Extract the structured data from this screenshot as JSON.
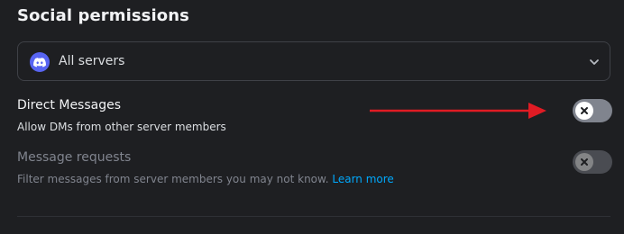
{
  "section": {
    "title": "Social permissions"
  },
  "server_select": {
    "value": "All servers",
    "icon": "discord-logo-icon",
    "accent": "#5865f2"
  },
  "settings": [
    {
      "title": "Direct Messages",
      "description": "Allow DMs from other server members",
      "enabled": false,
      "disabled": false
    },
    {
      "title": "Message requests",
      "description": "Filter messages from server members you may not know.",
      "link": "Learn more",
      "enabled": false,
      "disabled": true
    }
  ],
  "annotation": {
    "arrow_color": "#e01b24"
  }
}
